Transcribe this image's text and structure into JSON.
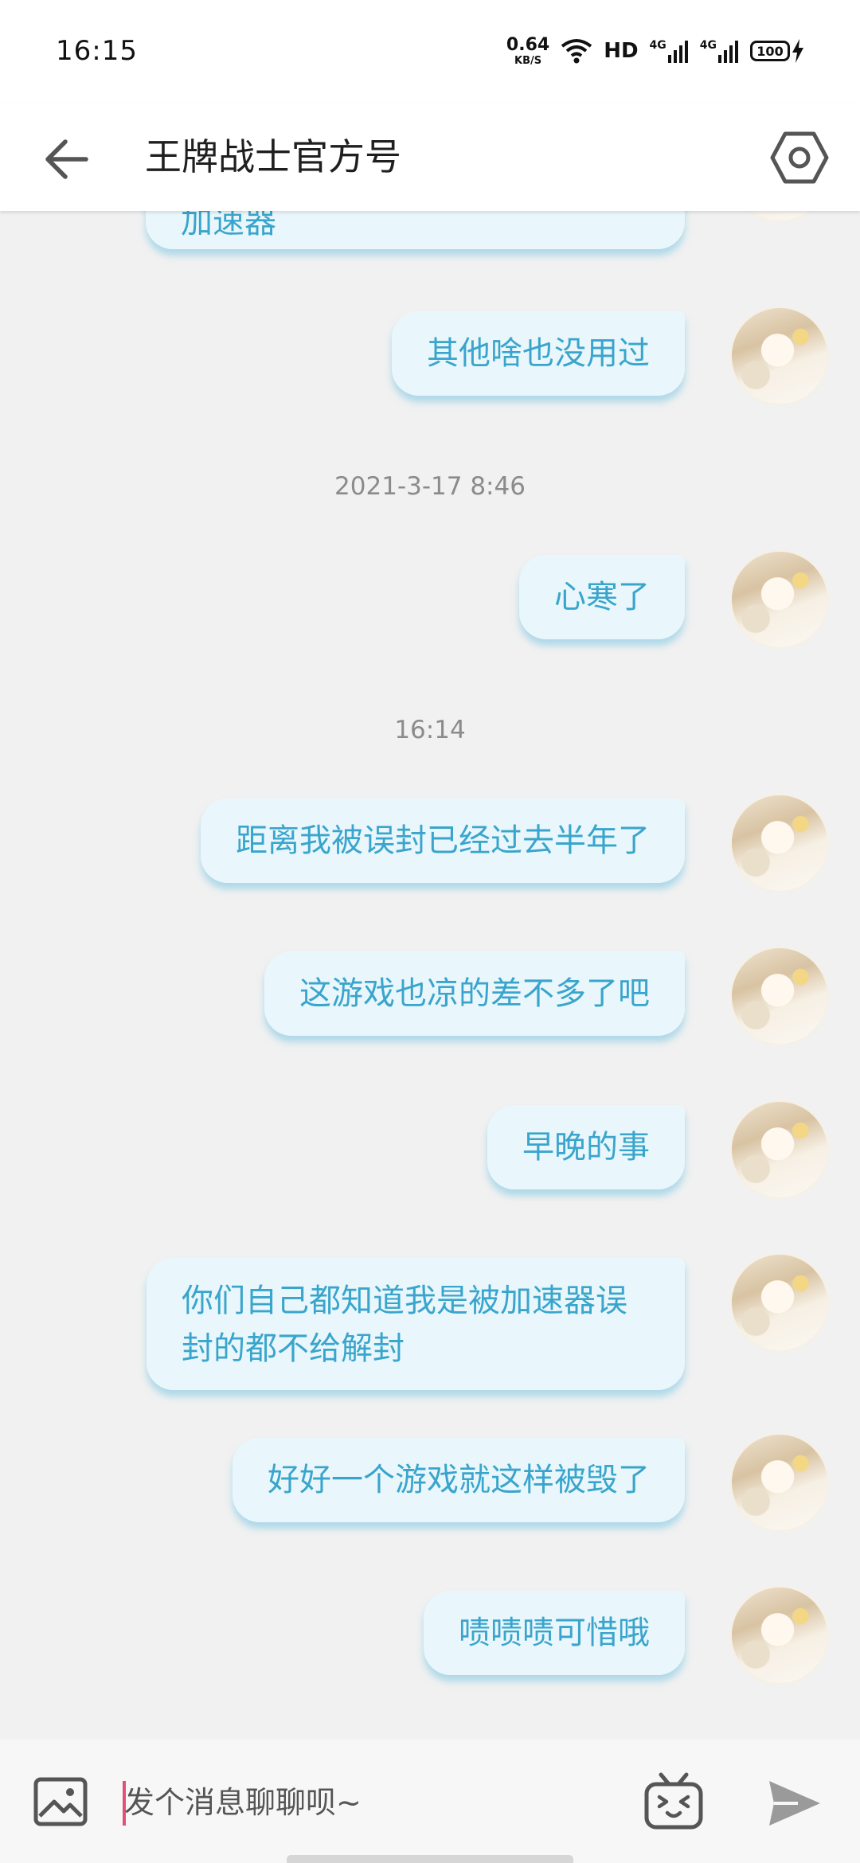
{
  "status_bar": {
    "time": "16:15",
    "net_speed_value": "0.64",
    "net_speed_unit": "KB/S",
    "hd_label": "HD",
    "signal1_label": "4G",
    "signal2_label": "4G",
    "battery_level": "100"
  },
  "header": {
    "title": "王牌战士官方号"
  },
  "chat": {
    "messages": [
      {
        "text": "加速器"
      },
      {
        "text": "其他啥也没用过"
      },
      {
        "text": "心寒了"
      },
      {
        "text": "距离我被误封已经过去半年了"
      },
      {
        "text": "这游戏也凉的差不多了吧"
      },
      {
        "text": "早晚的事"
      },
      {
        "text": "你们自己都知道我是被加速器误封的都不给解封"
      },
      {
        "text": "好好一个游戏就这样被毁了"
      },
      {
        "text": "啧啧啧可惜哦"
      }
    ],
    "timestamps": [
      "2021-3-17 8:46",
      "16:14"
    ]
  },
  "input_bar": {
    "placeholder": "发个消息聊聊呗~",
    "value": ""
  },
  "colors": {
    "bubble_bg": "#e9f7fc",
    "bubble_text": "#3aa5cc",
    "cursor": "#e2507a",
    "background": "#f1f1f1"
  },
  "icons": {
    "back": "arrow-left-icon",
    "settings": "hexagon-settings-icon",
    "image": "image-icon",
    "emoji": "tv-emoji-icon",
    "send": "send-icon"
  }
}
